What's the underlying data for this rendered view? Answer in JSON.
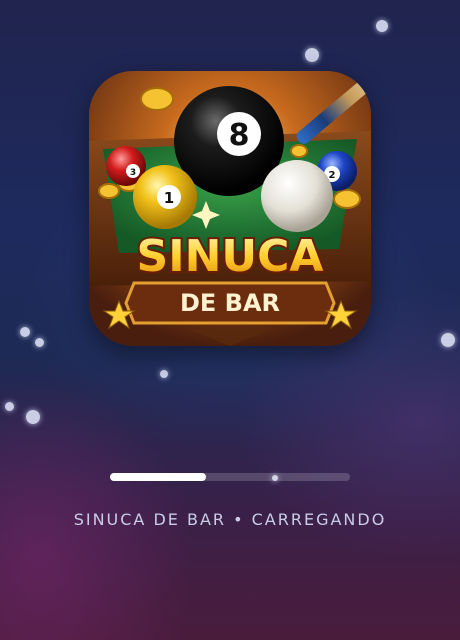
{
  "app_icon": {
    "name": "sinuca-de-bar-app-icon",
    "title_line1": "SINUCA",
    "title_line2": "DE BAR",
    "ball_numbers": [
      "8",
      "1",
      "3",
      "2"
    ]
  },
  "loading": {
    "progress_fraction": 0.4,
    "status_text": "SINUCA DE BAR • CARREGANDO"
  },
  "colors": {
    "progress_fill": "#ffffff",
    "status_text": "#c9cde6"
  }
}
